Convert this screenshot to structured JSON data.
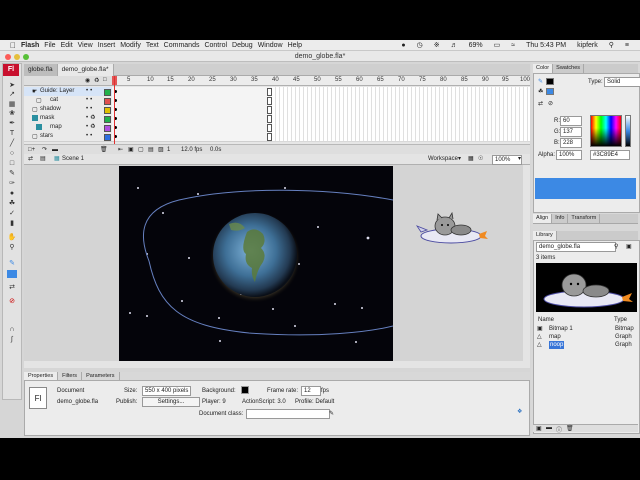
{
  "menubar": {
    "app": "Flash",
    "items": [
      "File",
      "Edit",
      "View",
      "Insert",
      "Modify",
      "Text",
      "Commands",
      "Control",
      "Debug",
      "Window",
      "Help"
    ],
    "battery": "69%",
    "clock": "Thu 5:43 PM",
    "user": "kipferk"
  },
  "window": {
    "title": "demo_globe.fla*"
  },
  "doc_tabs": [
    "globe.fla",
    "demo_globe.fla*"
  ],
  "timeline": {
    "ruler": [
      "5",
      "10",
      "15",
      "20",
      "25",
      "30",
      "35",
      "40",
      "45",
      "50",
      "55",
      "60",
      "65",
      "70",
      "75",
      "80",
      "85",
      "90",
      "95",
      "100"
    ],
    "layers": [
      {
        "name": "Guide: Layer",
        "color": "#22b14c"
      },
      {
        "name": "cat",
        "color": "#e05050"
      },
      {
        "name": "shadow",
        "color": "#e0c000"
      },
      {
        "name": "mask",
        "color": "#22b14c"
      },
      {
        "name": "map",
        "color": "#b050e0"
      },
      {
        "name": "stars",
        "color": "#3070e0"
      }
    ],
    "footer": {
      "frame": "1",
      "fps": "12.0 fps",
      "time": "0.0s"
    }
  },
  "editbar": {
    "scene": "Scene 1",
    "workspace": "Workspace",
    "zoom": "100%"
  },
  "properties": {
    "tabs": [
      "Properties",
      "Filters",
      "Parameters"
    ],
    "doc_label": "Document",
    "doc_name": "demo_globe.fla",
    "size_label": "Size:",
    "size_value": "550 x 400 pixels",
    "background_label": "Background:",
    "frame_rate_label": "Frame rate:",
    "frame_rate_value": "12",
    "fps_unit": "fps",
    "publish_label": "Publish:",
    "settings_button": "Settings...",
    "player_label": "Player: 9",
    "actionscript_label": "ActionScript: 3.0",
    "profile_label": "Profile: Default",
    "docclass_label": "Document class:"
  },
  "color_panel": {
    "tabs": [
      "Color",
      "Swatches"
    ],
    "type_label": "Type:",
    "type_value": "Solid",
    "r_label": "R:",
    "r_value": "60",
    "g_label": "G:",
    "g_value": "137",
    "b_label": "B:",
    "b_value": "228",
    "alpha_label": "Alpha:",
    "alpha_value": "100%",
    "hex_value": "#3C89E4",
    "current_color": "#3c89e4"
  },
  "align_tabs": [
    "Align",
    "Info",
    "Transform"
  ],
  "library": {
    "tab": "Library",
    "doc_select": "demo_globe.fla",
    "count": "3 items",
    "col_name": "Name",
    "col_type": "Type",
    "items": [
      {
        "name": "Bitmap 1",
        "type": "Bitmap"
      },
      {
        "name": "map",
        "type": "Graph"
      },
      {
        "name": "noop",
        "type": "Graph"
      }
    ]
  },
  "icons": {
    "tools": [
      "arrow-icon",
      "subselect-icon",
      "free-transform-icon",
      "lasso-icon",
      "pen-icon",
      "text-icon",
      "line-icon",
      "oval-icon",
      "rect-icon",
      "pencil-icon",
      "brush-icon",
      "ink-bottle-icon",
      "paint-bucket-icon",
      "eyedropper-icon",
      "eraser-icon",
      "hand-icon",
      "zoom-icon"
    ]
  }
}
